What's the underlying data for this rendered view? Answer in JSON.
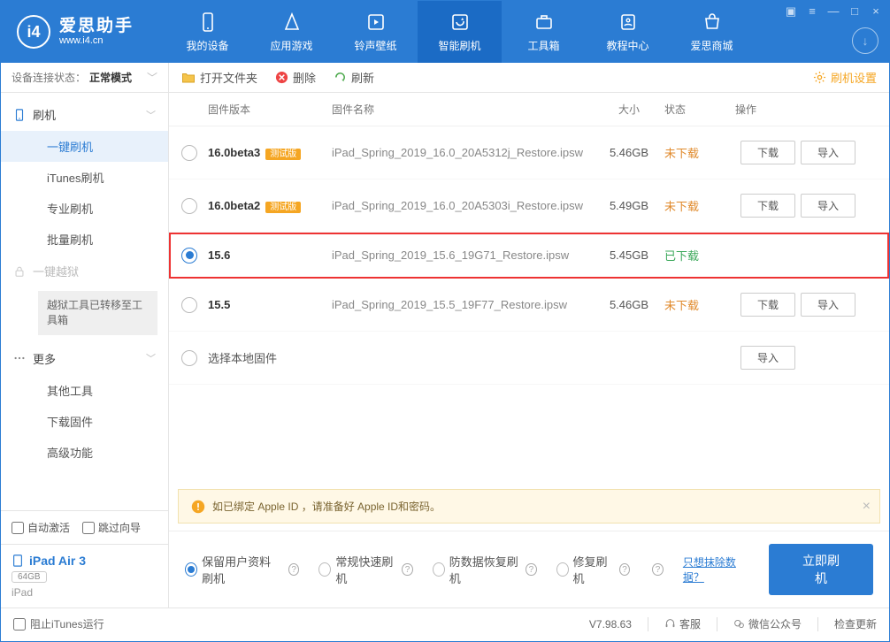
{
  "app": {
    "name": "爱思助手",
    "url": "www.i4.cn",
    "logo_glyph": "i4"
  },
  "top_tabs": [
    {
      "label": "我的设备"
    },
    {
      "label": "应用游戏"
    },
    {
      "label": "铃声壁纸"
    },
    {
      "label": "智能刷机",
      "active": true
    },
    {
      "label": "工具箱"
    },
    {
      "label": "教程中心"
    },
    {
      "label": "爱思商城"
    }
  ],
  "connection": {
    "label": "设备连接状态：",
    "status": "正常模式"
  },
  "sidebar": {
    "group_flash": "刷机",
    "items_flash": [
      "一键刷机",
      "iTunes刷机",
      "专业刷机",
      "批量刷机"
    ],
    "group_jailbreak": "一键越狱",
    "jailbreak_note": "越狱工具已转移至工具箱",
    "group_more": "更多",
    "items_more": [
      "其他工具",
      "下载固件",
      "高级功能"
    ]
  },
  "auto_activate": "自动激活",
  "skip_wizard": "跳过向导",
  "device": {
    "name": "iPad Air 3",
    "capacity": "64GB",
    "type": "iPad"
  },
  "toolbar": {
    "open": "打开文件夹",
    "delete": "删除",
    "refresh": "刷新",
    "settings": "刷机设置"
  },
  "columns": {
    "version": "固件版本",
    "name": "固件名称",
    "size": "大小",
    "status": "状态",
    "ops": "操作"
  },
  "status_labels": {
    "not": "未下载",
    "done": "已下载"
  },
  "op_labels": {
    "download": "下载",
    "import": "导入"
  },
  "firmware": [
    {
      "version": "16.0beta3",
      "badge": "测试版",
      "name": "iPad_Spring_2019_16.0_20A5312j_Restore.ipsw",
      "size": "5.46GB",
      "status": "not",
      "selected": false,
      "ops": [
        "download",
        "import"
      ]
    },
    {
      "version": "16.0beta2",
      "badge": "测试版",
      "name": "iPad_Spring_2019_16.0_20A5303i_Restore.ipsw",
      "size": "5.49GB",
      "status": "not",
      "selected": false,
      "ops": [
        "download",
        "import"
      ]
    },
    {
      "version": "15.6",
      "name": "iPad_Spring_2019_15.6_19G71_Restore.ipsw",
      "size": "5.45GB",
      "status": "done",
      "selected": true,
      "highlight": true,
      "ops": []
    },
    {
      "version": "15.5",
      "name": "iPad_Spring_2019_15.5_19F77_Restore.ipsw",
      "size": "5.46GB",
      "status": "not",
      "selected": false,
      "ops": [
        "download",
        "import"
      ]
    }
  ],
  "local_row": "选择本地固件",
  "warning": "如已绑定 Apple ID ，请准备好 Apple ID和密码。",
  "flash_options": [
    {
      "label": "保留用户资料刷机",
      "checked": true
    },
    {
      "label": "常规快速刷机",
      "checked": false
    },
    {
      "label": "防数据恢复刷机",
      "checked": false
    },
    {
      "label": "修复刷机",
      "checked": false
    }
  ],
  "erase_link": "只想抹除数据？",
  "flash_button": "立即刷机",
  "footer": {
    "block_itunes": "阻止iTunes运行",
    "version": "V7.98.63",
    "service": "客服",
    "wechat": "微信公众号",
    "update": "检查更新"
  }
}
